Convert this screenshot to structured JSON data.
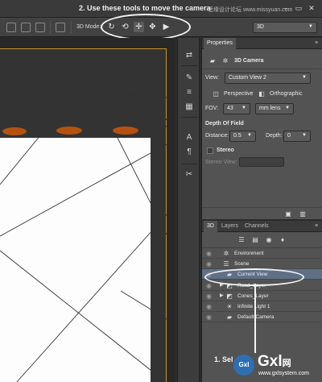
{
  "tutorial": {
    "caption": "2. Use these tools to move the camera",
    "step_label": "1. Sel"
  },
  "watermark": {
    "site": "思缘设计论坛 www.missyuan.com",
    "logo_mark": "Gxl",
    "logo_text": "Gxl",
    "logo_net": "网",
    "logo_url": "www.gxlsystem.com"
  },
  "window": {
    "minimize": "–",
    "restore": "▭",
    "close": "✕"
  },
  "options_bar": {
    "mode_label": "3D Mode:",
    "workspace_value": "3D",
    "camera_tools": [
      {
        "icon": "orbit-camera-icon",
        "glyph": "↻"
      },
      {
        "icon": "roll-camera-icon",
        "glyph": "⟲"
      },
      {
        "icon": "pan-camera-icon",
        "glyph": "✛"
      },
      {
        "icon": "walk-camera-icon",
        "glyph": "✥"
      },
      {
        "icon": "zoom-camera-icon",
        "glyph": "▶"
      }
    ]
  },
  "properties": {
    "tab": "Properties",
    "title": "3D Camera",
    "view_label": "View:",
    "view_value": "Custom View 2",
    "perspective": "Perspective",
    "orthographic": "Orthographic",
    "fov_label": "FOV:",
    "fov_value": "43",
    "fov_unit": "mm lens",
    "dof_header": "Depth Of Field",
    "distance_label": "Distance:",
    "distance_value": "0.5",
    "depth_label": "Depth:",
    "depth_value": "0",
    "stereo_label": "Stereo",
    "stereo_view_label": "Stereo View:"
  },
  "layers_panel": {
    "tabs": [
      "3D",
      "Layers",
      "Channels"
    ],
    "rows": [
      {
        "name": "Environment",
        "icon": "environment-icon",
        "glyph": "✲",
        "indent": 0,
        "expand": ""
      },
      {
        "name": "Scene",
        "icon": "scene-icon",
        "glyph": "☰",
        "indent": 0,
        "expand": ""
      },
      {
        "name": "Current View",
        "icon": "camera-icon",
        "glyph": "▰",
        "indent": 1,
        "expand": ""
      },
      {
        "name": "Road_Layer",
        "icon": "mesh-icon",
        "glyph": "◩",
        "indent": 1,
        "expand": "▶"
      },
      {
        "name": "Cones_Layer",
        "icon": "mesh-icon",
        "glyph": "◩",
        "indent": 1,
        "expand": "▶"
      },
      {
        "name": "Infinite Light 1",
        "icon": "light-icon",
        "glyph": "☀",
        "indent": 1,
        "expand": ""
      },
      {
        "name": "Default Camera",
        "icon": "camera-icon",
        "glyph": "▰",
        "indent": 1,
        "expand": ""
      }
    ]
  },
  "colors": {
    "accent_orange": "#c7922b",
    "cone_brown": "#b5520f",
    "selected_row": "#5f6f86"
  }
}
